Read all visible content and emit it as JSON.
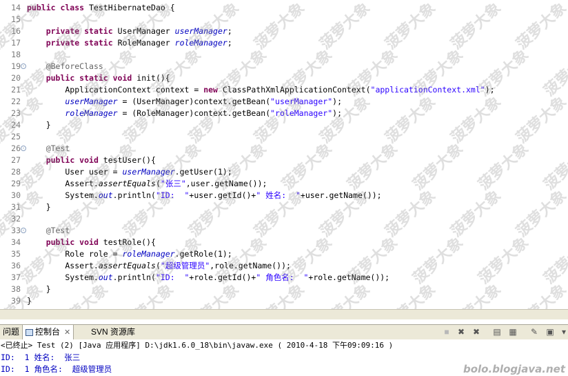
{
  "editor": {
    "lines": [
      {
        "n": "14",
        "fold": "",
        "parts": [
          [
            "kw",
            "public class "
          ],
          [
            "",
            "TestHibernateDao {"
          ]
        ]
      },
      {
        "n": "15",
        "fold": "",
        "parts": []
      },
      {
        "n": "16",
        "fold": "",
        "parts": [
          [
            "",
            "    "
          ],
          [
            "kw",
            "private static "
          ],
          [
            "",
            "UserManager "
          ],
          [
            "fld",
            "userManager"
          ],
          [
            "",
            ";"
          ]
        ]
      },
      {
        "n": "17",
        "fold": "",
        "parts": [
          [
            "",
            "    "
          ],
          [
            "kw",
            "private static "
          ],
          [
            "",
            "RoleManager "
          ],
          [
            "fld",
            "roleManager"
          ],
          [
            "",
            ";"
          ]
        ]
      },
      {
        "n": "18",
        "fold": "",
        "parts": []
      },
      {
        "n": "19",
        "fold": "⊖",
        "parts": [
          [
            "",
            "    "
          ],
          [
            "ann",
            "@BeforeClass"
          ]
        ]
      },
      {
        "n": "20",
        "fold": "",
        "parts": [
          [
            "",
            "    "
          ],
          [
            "kw",
            "public static void "
          ],
          [
            "",
            "init(){"
          ]
        ]
      },
      {
        "n": "21",
        "fold": "",
        "parts": [
          [
            "",
            "        ApplicationContext context = "
          ],
          [
            "kw",
            "new "
          ],
          [
            "",
            "ClassPathXmlApplicationContext("
          ],
          [
            "str",
            "\"applicationContext.xml\""
          ],
          [
            "",
            ");"
          ]
        ]
      },
      {
        "n": "22",
        "fold": "",
        "parts": [
          [
            "",
            "        "
          ],
          [
            "fld",
            "userManager"
          ],
          [
            "",
            " = (UserManager)context.getBean("
          ],
          [
            "str",
            "\"userManager\""
          ],
          [
            "",
            ");"
          ]
        ]
      },
      {
        "n": "23",
        "fold": "",
        "parts": [
          [
            "",
            "        "
          ],
          [
            "fld",
            "roleManager"
          ],
          [
            "",
            " = (RoleManager)context.getBean("
          ],
          [
            "str",
            "\"roleManager\""
          ],
          [
            "",
            ");"
          ]
        ]
      },
      {
        "n": "24",
        "fold": "",
        "parts": [
          [
            "",
            "    }"
          ]
        ]
      },
      {
        "n": "25",
        "fold": "",
        "parts": []
      },
      {
        "n": "26",
        "fold": "⊖",
        "parts": [
          [
            "",
            "    "
          ],
          [
            "ann",
            "@Test"
          ]
        ]
      },
      {
        "n": "27",
        "fold": "",
        "parts": [
          [
            "",
            "    "
          ],
          [
            "kw",
            "public void "
          ],
          [
            "",
            "testUser(){"
          ]
        ]
      },
      {
        "n": "28",
        "fold": "",
        "parts": [
          [
            "",
            "        User user = "
          ],
          [
            "fld",
            "userManager"
          ],
          [
            "",
            ".getUser(1);"
          ]
        ]
      },
      {
        "n": "29",
        "fold": "",
        "parts": [
          [
            "",
            "        Assert."
          ],
          [
            "smeth",
            "assertEquals"
          ],
          [
            "",
            "("
          ],
          [
            "str",
            "\"张三\""
          ],
          [
            "",
            ",user.getName());"
          ]
        ]
      },
      {
        "n": "30",
        "fold": "",
        "parts": [
          [
            "",
            "        System."
          ],
          [
            "stat",
            "out"
          ],
          [
            "",
            ".println("
          ],
          [
            "str",
            "\"ID:  \""
          ],
          [
            "",
            "+user.getId()+"
          ],
          [
            "str",
            "\" 姓名:  \""
          ],
          [
            "",
            "+user.getName());"
          ]
        ]
      },
      {
        "n": "31",
        "fold": "",
        "parts": [
          [
            "",
            "    }"
          ]
        ]
      },
      {
        "n": "32",
        "fold": "",
        "parts": []
      },
      {
        "n": "33",
        "fold": "⊖",
        "parts": [
          [
            "",
            "    "
          ],
          [
            "ann",
            "@Test"
          ]
        ]
      },
      {
        "n": "34",
        "fold": "",
        "parts": [
          [
            "",
            "    "
          ],
          [
            "kw",
            "public void "
          ],
          [
            "",
            "testRole(){"
          ]
        ]
      },
      {
        "n": "35",
        "fold": "",
        "parts": [
          [
            "",
            "        Role role = "
          ],
          [
            "fld",
            "roleManager"
          ],
          [
            "",
            ".getRole(1);"
          ]
        ]
      },
      {
        "n": "36",
        "fold": "",
        "parts": [
          [
            "",
            "        Assert."
          ],
          [
            "smeth",
            "assertEquals"
          ],
          [
            "",
            "("
          ],
          [
            "str",
            "\"超级管理员\""
          ],
          [
            "",
            ",role.getName());"
          ]
        ]
      },
      {
        "n": "37",
        "fold": "",
        "parts": [
          [
            "",
            "        System."
          ],
          [
            "stat",
            "out"
          ],
          [
            "",
            ".println("
          ],
          [
            "str",
            "\"ID:  \""
          ],
          [
            "",
            "+role.getId()+"
          ],
          [
            "str",
            "\" 角色名:  \""
          ],
          [
            "",
            "+role.getName());"
          ]
        ]
      },
      {
        "n": "38",
        "fold": "",
        "parts": [
          [
            "",
            "    }"
          ]
        ]
      },
      {
        "n": "39",
        "fold": "",
        "parts": [
          [
            "",
            "}"
          ]
        ]
      }
    ]
  },
  "watermark_text": "菠萝大象",
  "tabs": {
    "problems": "问题",
    "console": "控制台",
    "console_close": "✕",
    "svn": "SVN 资源库"
  },
  "toolbar_icons": [
    "terminate-icon",
    "remove-launch-icon",
    "remove-all-icon",
    "clear-console-icon",
    "scroll-lock-icon",
    "pin-console-icon",
    "display-console-icon",
    "view-menu-icon"
  ],
  "console": {
    "header": "<已终止> Test (2) [Java 应用程序] D:\\jdk1.6.0_18\\bin\\javaw.exe ( 2010-4-18 下午09:09:16 )",
    "lines": [
      "ID:  1 姓名:  张三",
      "ID:  1 角色名:  超级管理员"
    ]
  },
  "footer_watermark": "bolo.blogjava.net",
  "colors": {
    "keyword": "#7f0055",
    "string": "#2a00ff",
    "field": "#0000c0",
    "annotation": "#646464",
    "console_output": "#0000c0",
    "panel_bg": "#ece9d8"
  }
}
